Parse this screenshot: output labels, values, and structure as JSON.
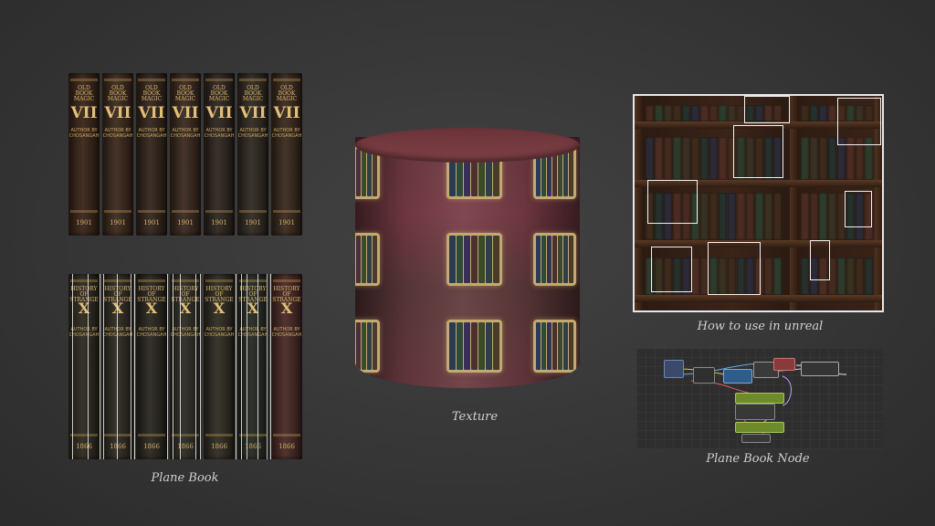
{
  "captions": {
    "plane_book": "Plane Book",
    "texture": "Texture",
    "how_to_use": "How to use in unreal",
    "plane_book_node": "Plane Book Node"
  },
  "top_books": {
    "title_line": "OLD BOOK MAGIC",
    "volume": "VII",
    "author": "AUTHOR BY CHOSANGAH",
    "year": "1901",
    "count": 7,
    "colors": [
      "#3a2519",
      "#3d2a1e",
      "#34261d",
      "#3b2a20",
      "#2f2620",
      "#312a22",
      "#3a2a1e"
    ]
  },
  "bottom_books": {
    "title_line": "HISTORY OF STRANGE",
    "volume": "X",
    "author": "AUTHOR BY CHOSANGAH",
    "year": "1866",
    "count": 7,
    "colors": [
      "#2d2a1f",
      "#2f2b22",
      "#2a2720",
      "#2d2b23",
      "#302d23",
      "#262a22",
      "#4a2a26"
    ]
  },
  "palette": {
    "background": "#363636",
    "caption": "#cfcfcf",
    "gold": "#d9b66e",
    "highlight": "#f2f2f2"
  }
}
